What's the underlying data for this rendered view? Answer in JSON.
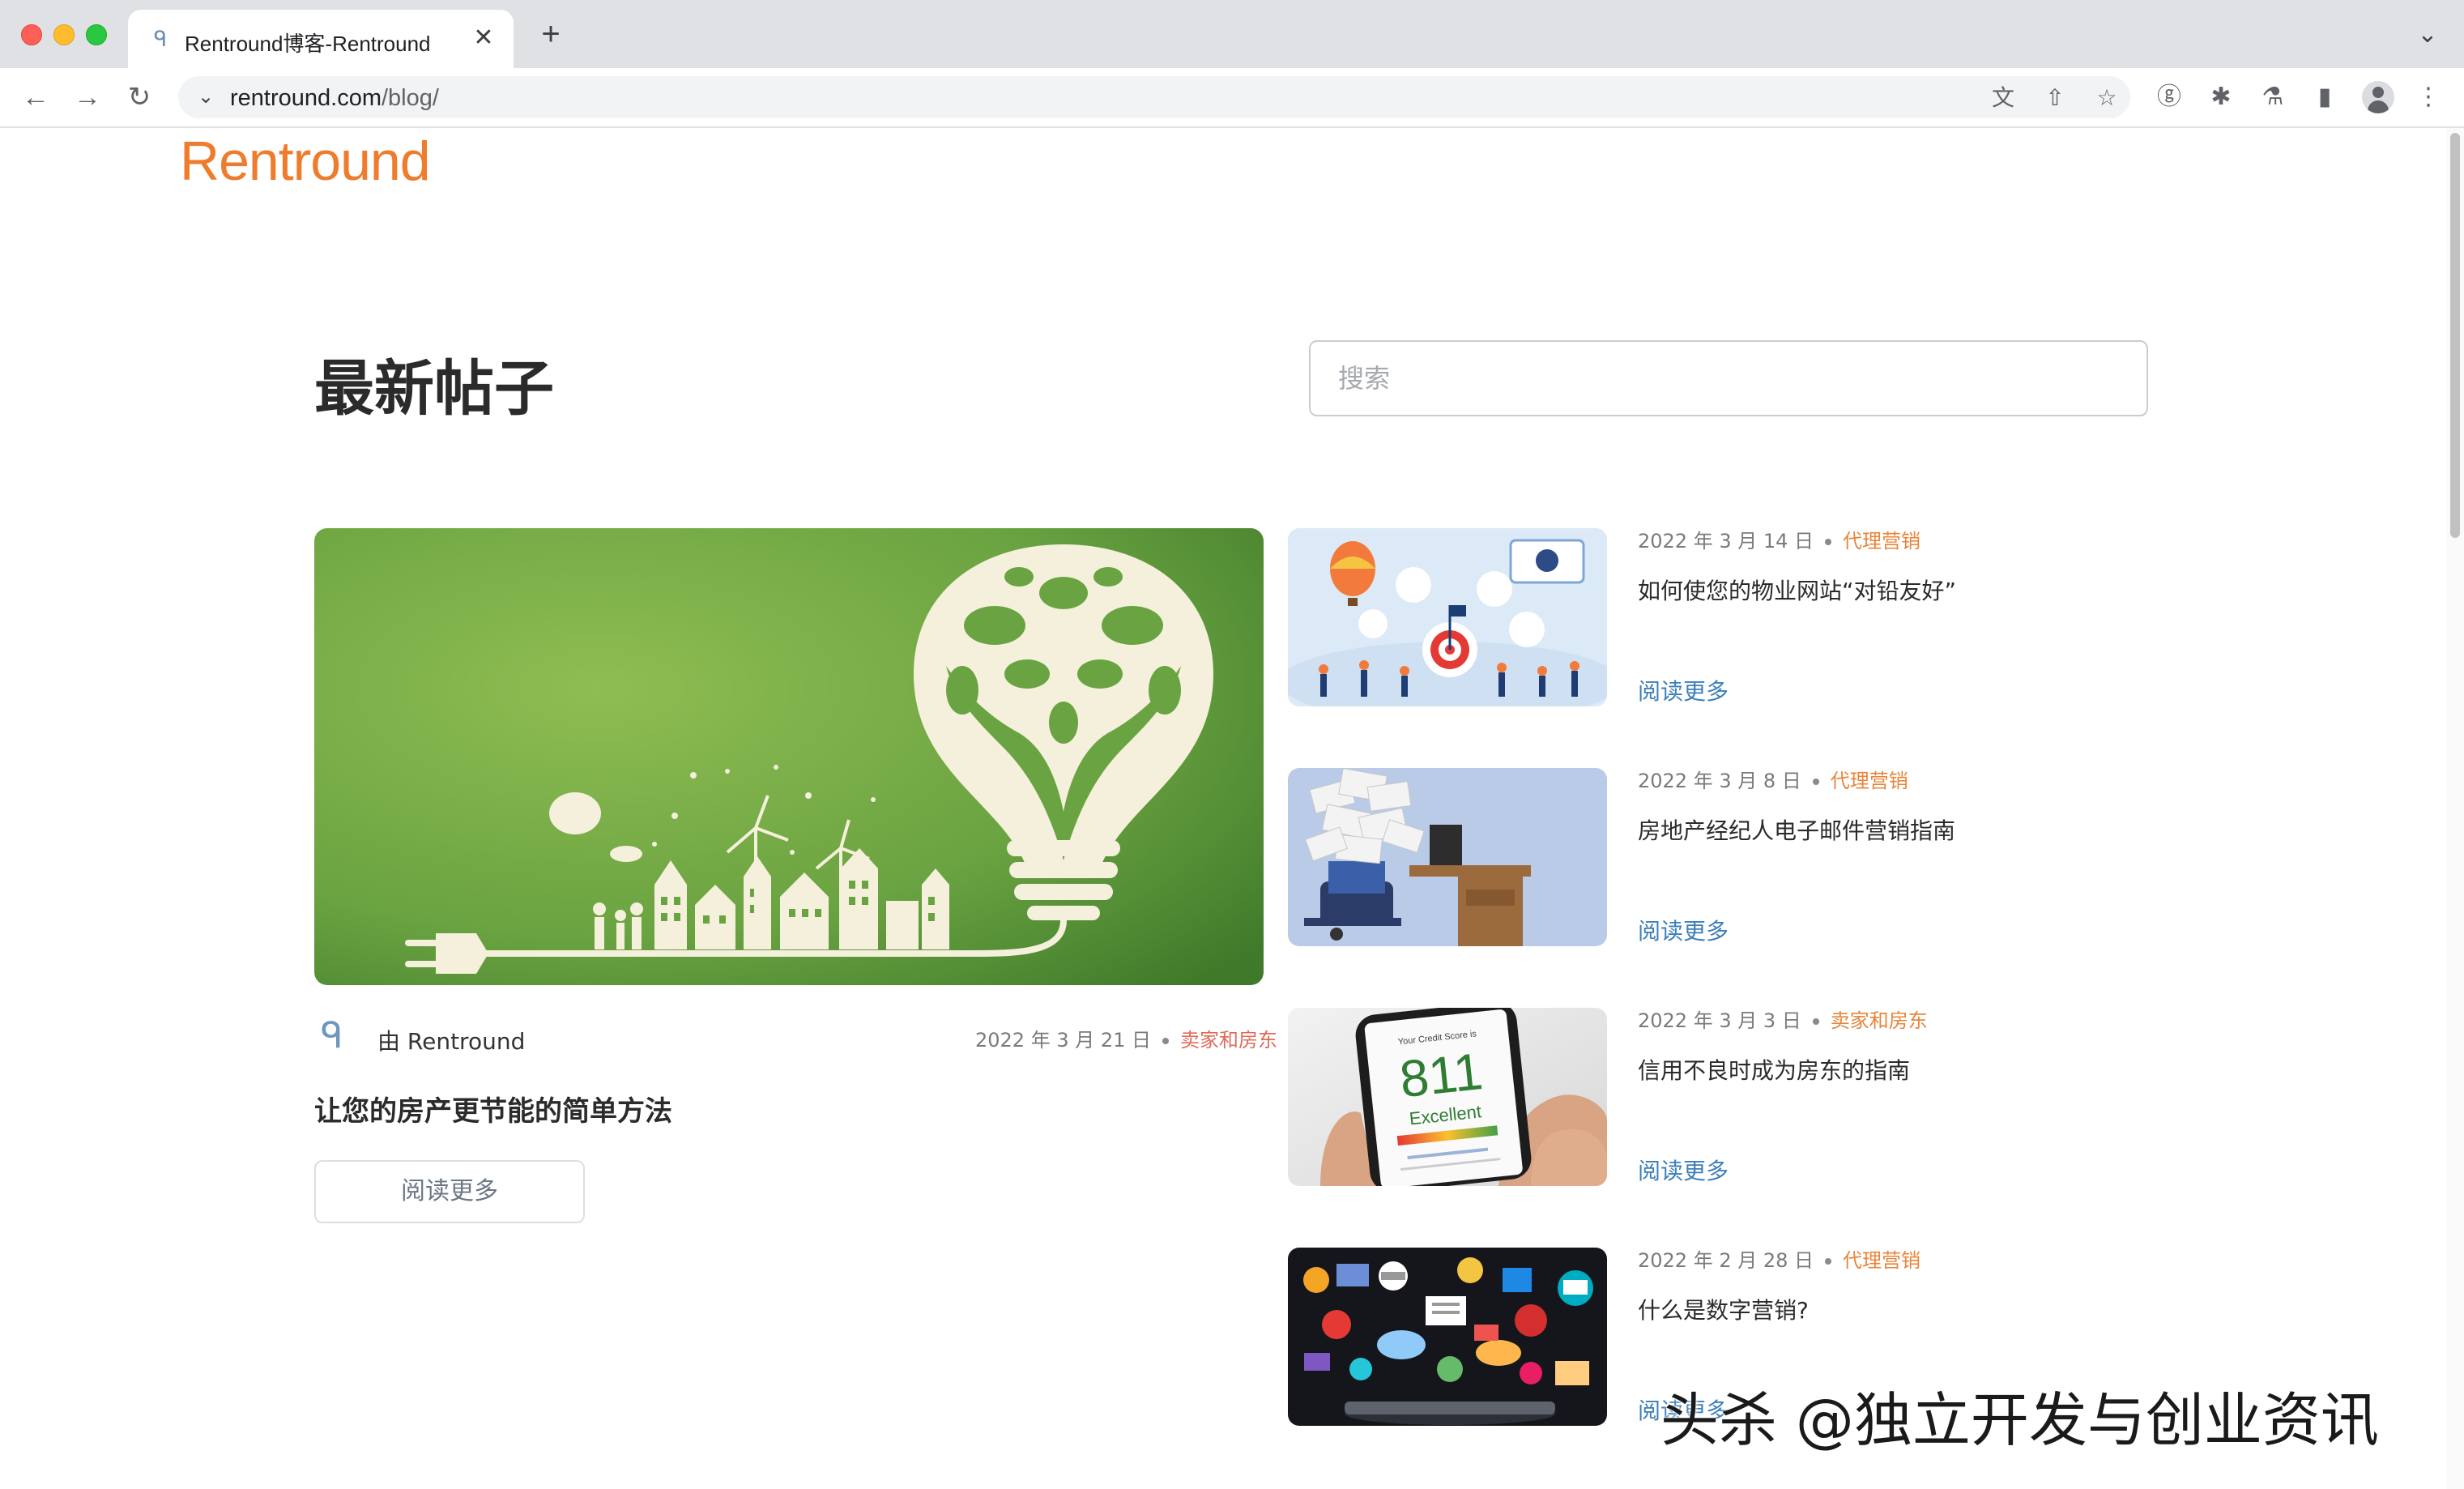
{
  "browser": {
    "tab_title": "Rentround博客-Rentround",
    "tab_close": "✕",
    "new_tab": "+",
    "url_host": "rentround.com",
    "url_path": "/blog/"
  },
  "site": {
    "logo": "Rentround"
  },
  "page": {
    "title": "最新帖子",
    "search_placeholder": "搜索"
  },
  "featured": {
    "author": "由 Rentround",
    "date": "2022 年 3 月 21 日",
    "category": "卖家和房东",
    "title": "让您的房产更节能的简单方法",
    "read_more": "阅读更多"
  },
  "posts": [
    {
      "date": "2022 年 3 月 14 日",
      "category": "代理营销",
      "title": "如何使您的物业网站“对铅友好”",
      "read_more": "阅读更多"
    },
    {
      "date": "2022 年 3 月 8 日",
      "category": "代理营销",
      "title": "房地产经纪人电子邮件营销指南",
      "read_more": "阅读更多"
    },
    {
      "date": "2022 年 3 月 3 日",
      "category": "卖家和房东",
      "title": "信用不良时成为房东的指南",
      "read_more": "阅读更多",
      "image_text": {
        "score": "811",
        "rating": "Excellent",
        "caption": "Your Credit Score is"
      }
    },
    {
      "date": "2022 年 2 月 28 日",
      "category": "代理营销",
      "title": "什么是数字营销?",
      "read_more": "阅读更多"
    }
  ],
  "watermark": "头杀 @独立开发与创业资讯",
  "colors": {
    "brand": "#ef7c2c",
    "link": "#3d7fb8",
    "category_orange": "#e8853a",
    "category_red": "#e06b5a",
    "feature_green": "#6aa341"
  }
}
